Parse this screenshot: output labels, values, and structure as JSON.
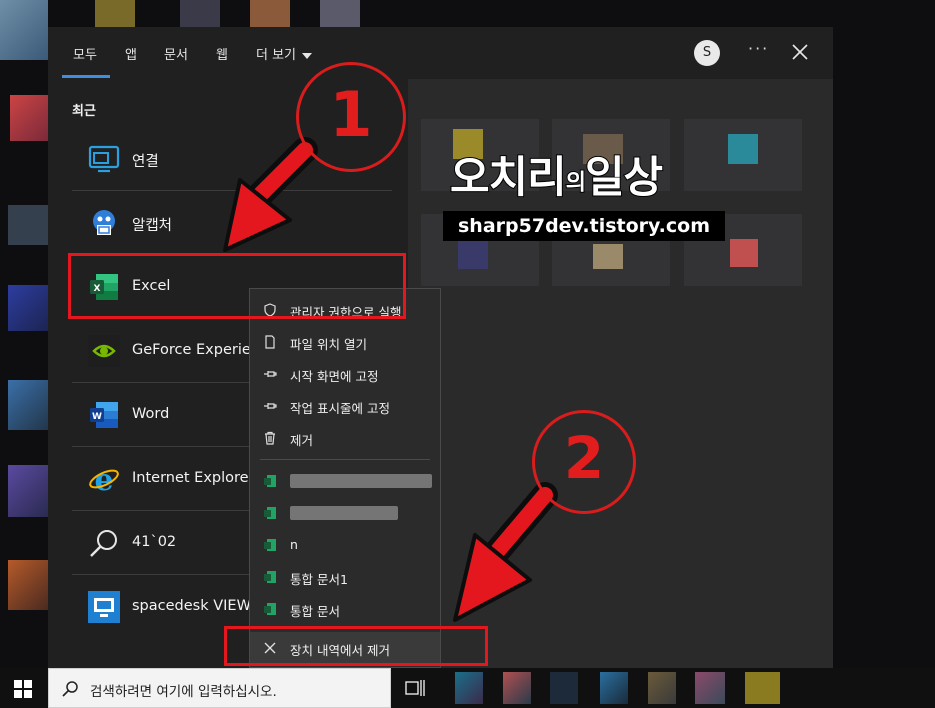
{
  "tabs": [
    {
      "label": "모두",
      "active": true
    },
    {
      "label": "앱"
    },
    {
      "label": "문서"
    },
    {
      "label": "웹"
    },
    {
      "label": "더 보기"
    }
  ],
  "account_initial": "S",
  "more_options": "···",
  "recent_heading": "최근",
  "recent_apps": [
    {
      "label": "연결",
      "icon": "connect-icon"
    },
    {
      "label": "알캡처",
      "icon": "alcapture-icon"
    },
    {
      "label": "Excel",
      "icon": "excel-icon"
    },
    {
      "label": "GeForce Experien",
      "icon": "nvidia-icon"
    },
    {
      "label": "Word",
      "icon": "word-icon"
    },
    {
      "label": "Internet Explorer",
      "icon": "ie-icon"
    },
    {
      "label": "41`02",
      "icon": "search-icon"
    },
    {
      "label": "spacedesk VIEWE",
      "icon": "spacedesk-icon"
    }
  ],
  "context_menu": {
    "actions": [
      {
        "label": "관리자 권한으로 실행",
        "icon": "shield-icon"
      },
      {
        "label": "파일 위치 열기",
        "icon": "folder-icon"
      },
      {
        "label": "시작 화면에 고정",
        "icon": "pin-icon"
      },
      {
        "label": "작업 표시줄에 고정",
        "icon": "pin-icon"
      },
      {
        "label": "제거",
        "icon": "trash-icon"
      }
    ],
    "recent_files": [
      {
        "label": ""
      },
      {
        "label": ""
      },
      {
        "label": "n"
      },
      {
        "label": "통합 문서1"
      },
      {
        "label": "통합 문서"
      }
    ],
    "remove_from_history": "장치 내역에서 제거"
  },
  "taskbar": {
    "search_placeholder": "검색하려면 여기에 입력하십시오."
  },
  "annotations": {
    "step1": "1",
    "step2": "2"
  },
  "watermark": {
    "title_a": "오치리",
    "title_b": "의",
    "title_c": "일상",
    "url": "sharp57dev.tistory.com"
  },
  "colors": {
    "accent": "#3d8fe0",
    "annotation_red": "#e3171d",
    "panel_bg": "#202020"
  }
}
